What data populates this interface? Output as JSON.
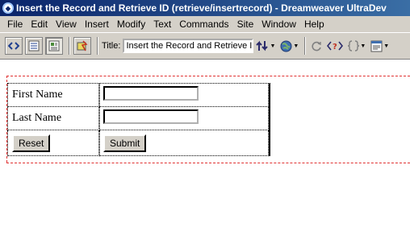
{
  "window": {
    "title": "Insert the Record and Retrieve ID (retrieve/insertrecord) - Dreamweaver UltraDev"
  },
  "menu": [
    "File",
    "Edit",
    "View",
    "Insert",
    "Modify",
    "Text",
    "Commands",
    "Site",
    "Window",
    "Help"
  ],
  "toolbar": {
    "title_label": "Title:",
    "title_value": "Insert the Record and Retrieve ID"
  },
  "form": {
    "first_name_label": "First Name",
    "last_name_label": "Last Name",
    "reset_label": "Reset",
    "submit_label": "Submit"
  }
}
